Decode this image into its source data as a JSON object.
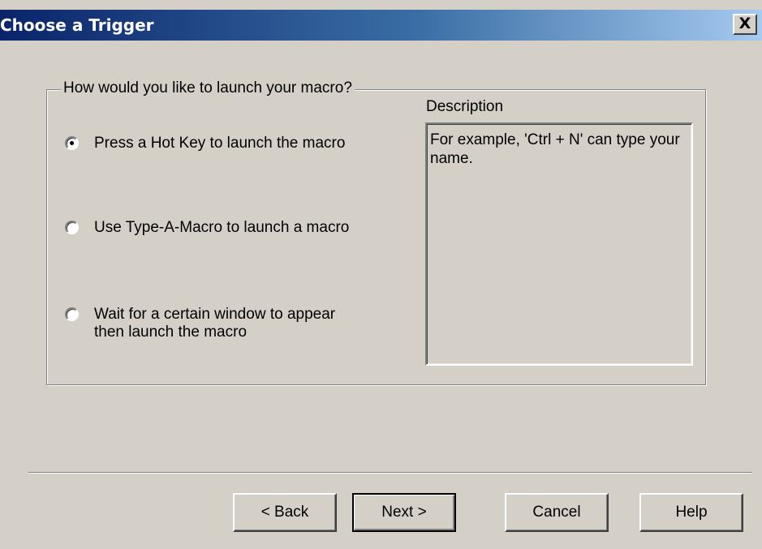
{
  "window": {
    "title": "Choose a Trigger",
    "close_label": "X"
  },
  "group": {
    "legend": "How would you like to launch your macro?"
  },
  "options": [
    {
      "label": "Press a Hot Key to launch the macro",
      "selected": true
    },
    {
      "label": "Use Type-A-Macro to launch a macro",
      "selected": false
    },
    {
      "label": "Wait for a certain window to appear\nthen launch the macro",
      "selected": false
    }
  ],
  "description": {
    "label": "Description",
    "text": "For example, 'Ctrl + N' can type your name."
  },
  "buttons": {
    "back": "< Back",
    "next": "Next >",
    "cancel": "Cancel",
    "help": "Help"
  },
  "colors": {
    "title_start": "#0a246a",
    "title_end": "#a6caf0",
    "face": "#d4d0c8"
  }
}
